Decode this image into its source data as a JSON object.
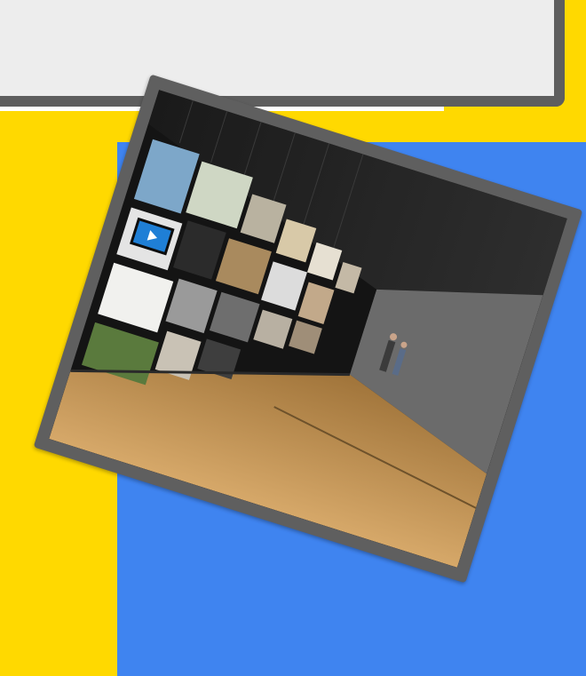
{
  "scene": {
    "image_icon": "photo-icon",
    "play_icon": "play-icon",
    "colors": {
      "yellow": "#FFD900",
      "blue": "#3F84F0",
      "frame_gray": "#5F5F5F",
      "card_gray": "#EDEDED",
      "card_border": "#5E5E5E"
    }
  }
}
